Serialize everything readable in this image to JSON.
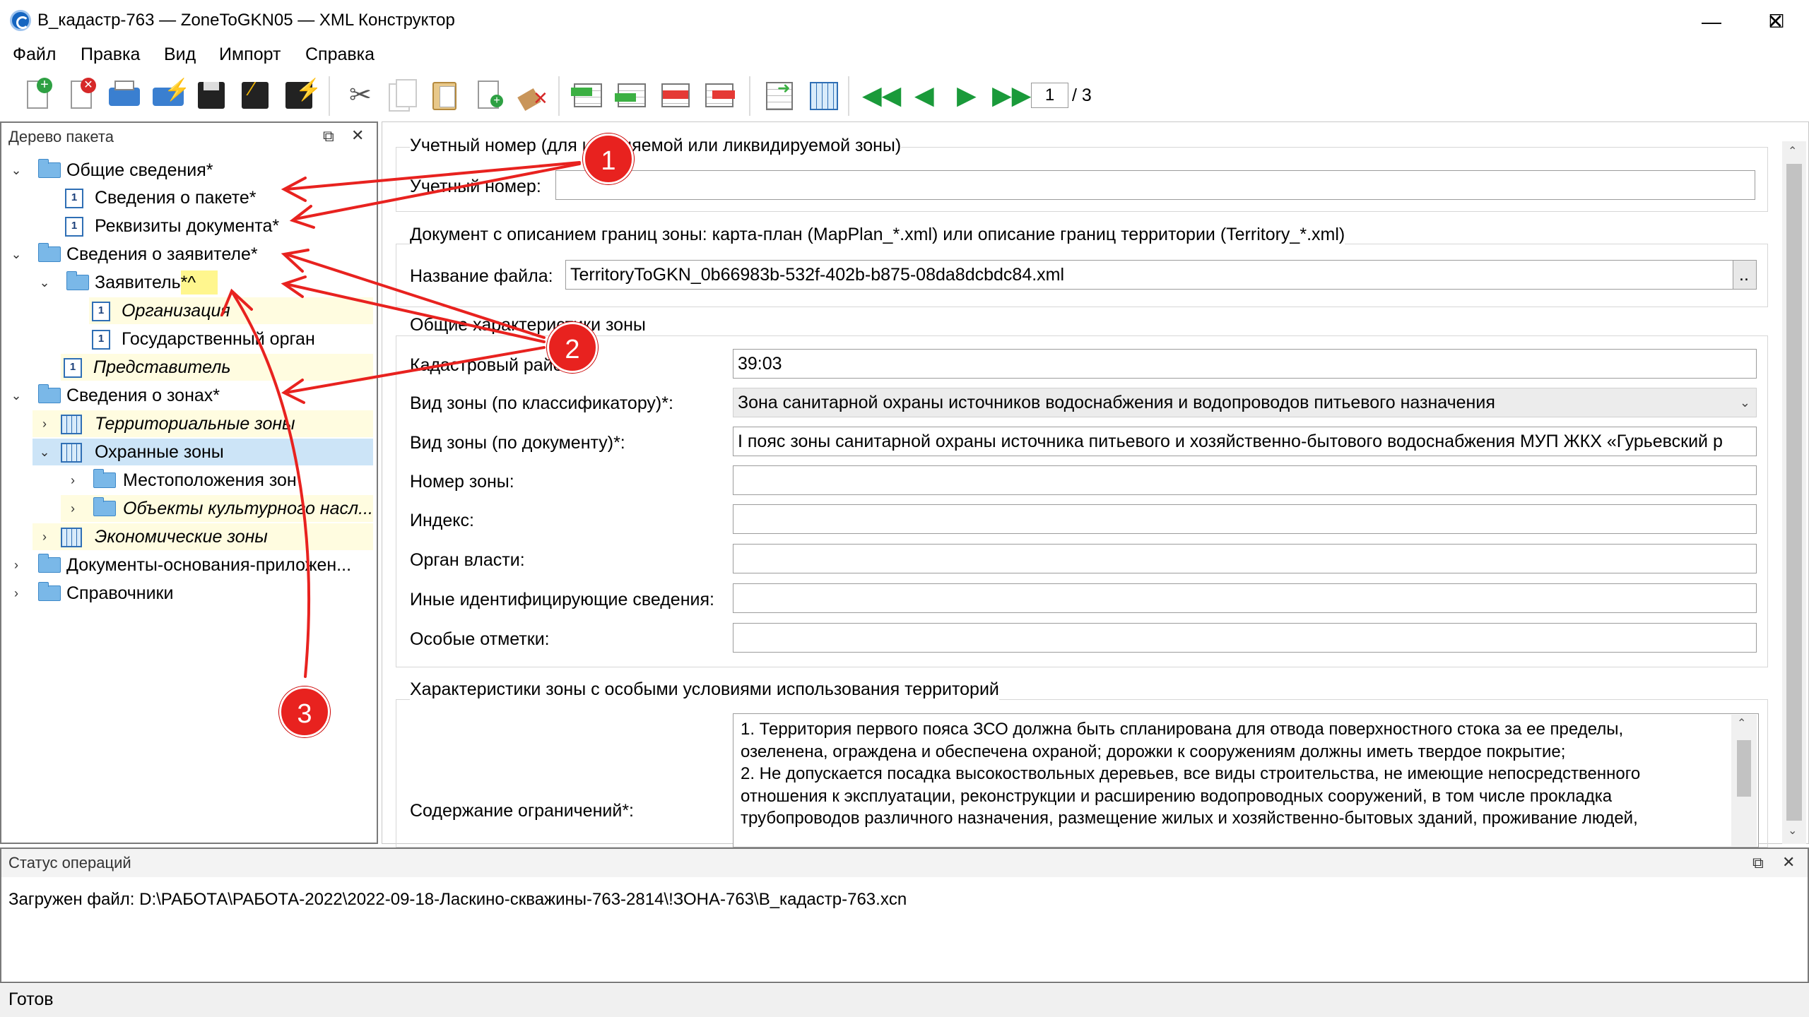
{
  "window": {
    "title": "В_кадастр-763 — ZoneToGKN05 — XML Конструктор",
    "controls": {
      "minimize": "—",
      "maximize": "☐",
      "close": "✕"
    }
  },
  "menu": [
    "Файл",
    "Правка",
    "Вид",
    "Импорт",
    "Справка"
  ],
  "toolbar": {
    "icons": [
      "new-doc-icon",
      "delete-doc-icon",
      "print-icon",
      "validate-icon",
      "save-icon",
      "save-as-icon",
      "save-sign-icon",
      "cut-icon",
      "copy-icon",
      "paste-icon",
      "paste-new-icon",
      "clear-icon",
      "insert-row-before-icon",
      "insert-row-after-icon",
      "delete-row-icon",
      "move-row-icon",
      "export-icon",
      "table-icon",
      "first-icon",
      "prev-icon",
      "next-icon",
      "last-icon"
    ],
    "page_current": "1",
    "page_total": "/ 3"
  },
  "tree_panel": {
    "title": "Дерево пакета",
    "items": [
      {
        "label": "Общие сведения*"
      },
      {
        "label": "Сведения о пакете*"
      },
      {
        "label": "Реквизиты документа*"
      },
      {
        "label": "Сведения о заявителе*"
      },
      {
        "label": "Заявитель*^"
      },
      {
        "label": "Организация"
      },
      {
        "label": "Государственный орган"
      },
      {
        "label": "Представитель"
      },
      {
        "label": "Сведения о зонах*"
      },
      {
        "label": "Территориальные зоны"
      },
      {
        "label": "Охранные зоны"
      },
      {
        "label": "Местоположения зон"
      },
      {
        "label": "Объекты культурного насл..."
      },
      {
        "label": "Экономические зоны"
      },
      {
        "label": "Документы-основания-приложен..."
      },
      {
        "label": "Справочники"
      }
    ]
  },
  "form": {
    "group1": {
      "title": "Учетный номер (для изменяемой или ликвидируемой зоны)",
      "account_label": "Учетный номер:",
      "account_value": ""
    },
    "group2": {
      "title": "Документ с описанием границ зоны: карта-план (MapPlan_*.xml) или описание границ территории (Territory_*.xml)",
      "file_label": "Название файла:",
      "file_value": "TerritoryToGKN_0b66983b-532f-402b-b875-08da8dcbdc84.xml",
      "browse_label": ".."
    },
    "group3": {
      "title": "Общие характеристики зоны",
      "cad_label": "Кадастровый район",
      "cad_value": "39:03",
      "zone_kind_label": "Вид зоны (по классификатору)*:",
      "zone_kind_value": "Зона санитарной охраны источников водоснабжения и водопроводов питьевого назначения",
      "zone_doc_label": "Вид зоны (по документу)*:",
      "zone_doc_value": "I пояс зоны санитарной охраны источника питьевого и хозяйственно-бытового водоснабжения МУП ЖКХ «Гурьевский р",
      "number_label": "Номер зоны:",
      "index_label": "Индекс:",
      "authority_label": "Орган власти:",
      "other_label": "Иные идентифицирующие сведения:",
      "notes_label": "Особые отметки:"
    },
    "group4": {
      "title": "Характеристики зоны с особыми условиями использования территорий",
      "restrictions_label": "Содержание ограничений*:",
      "restrictions_lines": [
        "1. Территория первого пояса ЗСО должна быть спланирована для отвода поверхностного стока за ее пределы,",
        "озеленена, ограждена и обеспечена охраной; дорожки к сооружениям должны иметь твердое покрытие;",
        "2. Не допускается посадка высокоствольных деревьев, все виды строительства, не имеющие непосредственного",
        "отношения к эксплуатации, реконструкции и расширению водопроводных сооружений, в том числе прокладка",
        "трубопроводов различного назначения, размещение жилых и хозяйственно-бытовых зданий, проживание людей,"
      ]
    }
  },
  "status_panel": {
    "title": "Статус операций",
    "message": "Загружен файл: D:\\РАБОТА\\РАБОТА-2022\\2022-09-18-Ласкино-скважины-763-2814\\!ЗОНА-763\\В_кадастр-763.xcn"
  },
  "statusbar": "Готов",
  "annotations": {
    "badge1": "1",
    "badge2": "2",
    "badge3": "3",
    "color": "#e8221f"
  }
}
